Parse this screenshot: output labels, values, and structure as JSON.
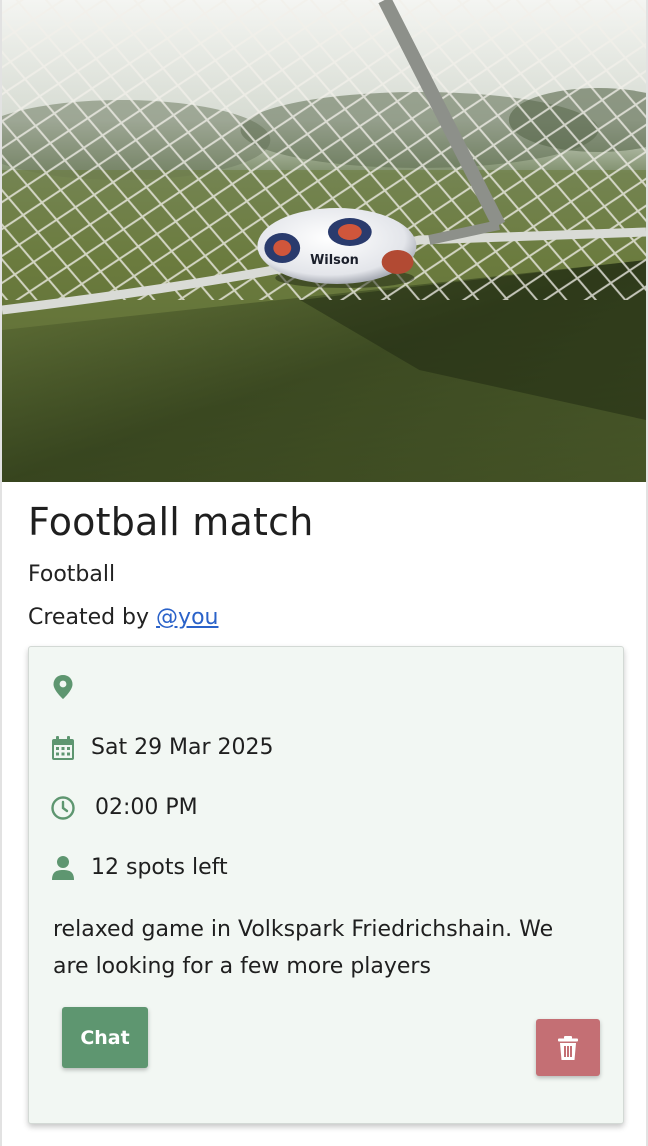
{
  "event": {
    "title": "Football match",
    "sport": "Football",
    "created_by_prefix": "Created by",
    "creator_handle": "@you"
  },
  "details": {
    "location": "",
    "date": "Sat 29 Mar 2025",
    "time": "02:00 PM",
    "spots": "12 spots left",
    "description": "relaxed game in Volkspark Friedrichshain. We are looking for a few more players"
  },
  "actions": {
    "chat_label": "Chat"
  },
  "icons": {
    "location": "map-pin-icon",
    "date": "calendar-icon",
    "time": "clock-icon",
    "spots": "user-icon",
    "delete": "trash-icon"
  },
  "colors": {
    "icon_green": "#5e9670",
    "chat_button": "#5e9670",
    "delete_button": "#c46f74",
    "card_background": "#f2f7f3",
    "link": "#2a62c9"
  }
}
